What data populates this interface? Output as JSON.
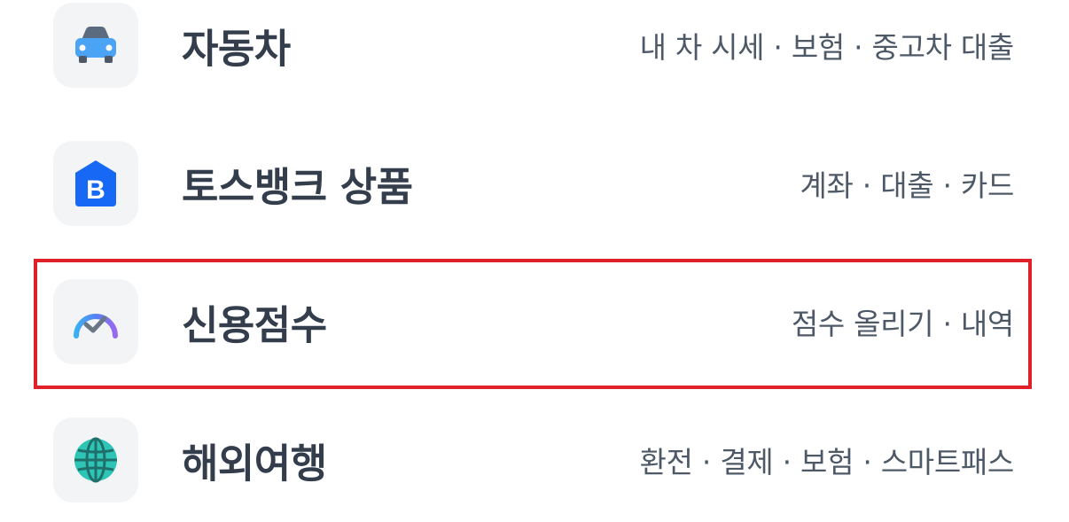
{
  "menu": {
    "items": [
      {
        "title": "자동차",
        "subtitle": "내 차 시세 · 보험 · 중고차 대출",
        "icon": "car-icon"
      },
      {
        "title": "토스뱅크 상품",
        "subtitle": "계좌 · 대출 · 카드",
        "icon": "toss-bank-b-icon"
      },
      {
        "title": "신용점수",
        "subtitle": "점수 올리기 · 내역",
        "icon": "credit-score-gauge-icon"
      },
      {
        "title": "해외여행",
        "subtitle": "환전 · 결제 · 보험 · 스마트패스",
        "icon": "globe-icon"
      }
    ]
  },
  "colors": {
    "title": "#333d4b",
    "subtitle": "#4e5968",
    "icon_bg": "#f2f4f6",
    "car_blue": "#4aa3f5",
    "bank_blue": "#1768f5",
    "highlight_red": "#e0212a",
    "globe_teal": "#2ec4b6"
  }
}
